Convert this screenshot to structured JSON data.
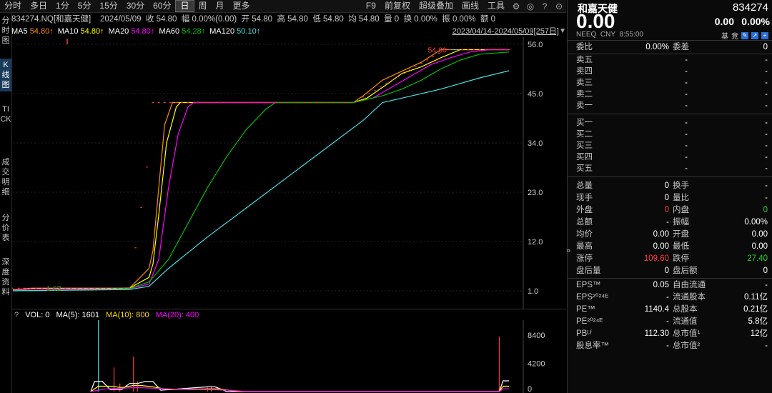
{
  "toolbar": {
    "periods": [
      "分时",
      "多日",
      "1分",
      "5分",
      "15分",
      "30分",
      "60分",
      "日",
      "周",
      "月",
      "更多"
    ],
    "active_period": "日",
    "right_items": [
      "F9",
      "前复权",
      "超级叠加",
      "画线",
      "工具"
    ]
  },
  "left_tabs": [
    "分时图",
    "K线图",
    "TICK",
    "成交明细",
    "分价表",
    "深度资料"
  ],
  "info": {
    "code_name": "834274.NQ[和嘉天健]",
    "date": "2024/05/09",
    "close": "收 54.80",
    "change": "幅 0.00%(0.00)",
    "open": "开 54.80",
    "high": "高 54.80",
    "low": "低 54.80",
    "avg": "均 54.80",
    "volume": "量 0",
    "turnover": "换 0.00%",
    "amplitude": "振 0.00%",
    "amount": "额 0"
  },
  "ma": {
    "items": [
      {
        "name": "MA5",
        "value": "54.80↑",
        "color": "#ffffff",
        "vcolor": "#ff8c00"
      },
      {
        "name": "MA10",
        "value": "54.80↑",
        "color": "#ffffff",
        "vcolor": "#ffff00"
      },
      {
        "name": "MA20",
        "value": "54.80↑",
        "color": "#ffffff",
        "vcolor": "#ff00ff"
      },
      {
        "name": "MA60",
        "value": "54.28↑",
        "color": "#ffffff",
        "vcolor": "#00c000"
      },
      {
        "name": "MA120",
        "value": "50.10↑",
        "color": "#ffffff",
        "vcolor": "#40e0e0"
      }
    ],
    "range": "2023/04/14-2024/05/09[257日]"
  },
  "chart_data": {
    "type": "line",
    "yticks": [
      1.0,
      12.0,
      23.0,
      34.0,
      45.0,
      56.0
    ],
    "ylim": [
      1.0,
      56.0
    ],
    "annotations": [
      {
        "text": "54.80",
        "x": 228,
        "y": 54.8
      },
      {
        "text": "1.62",
        "x": 32,
        "y": 1.62
      }
    ],
    "series": [
      {
        "name": "MA5",
        "color": "#ff8c00",
        "x": [
          0,
          10,
          50,
          60,
          70,
          72,
          75,
          78,
          82,
          84,
          100,
          175,
          180,
          190,
          200,
          210,
          220,
          228,
          240,
          255
        ],
        "y": [
          1.2,
          1.6,
          1.6,
          1.6,
          6,
          10,
          24,
          38,
          43,
          43,
          43,
          43,
          44.5,
          48,
          50,
          52,
          54.8,
          54.8,
          54.8,
          54.8
        ]
      },
      {
        "name": "MA10",
        "color": "#ffff00",
        "x": [
          0,
          10,
          50,
          60,
          70,
          72,
          75,
          79,
          84,
          86,
          100,
          175,
          182,
          192,
          200,
          210,
          220,
          230,
          240,
          255
        ],
        "y": [
          1.2,
          1.5,
          1.5,
          1.6,
          4,
          7,
          18,
          34,
          42,
          43,
          43,
          43,
          44,
          47,
          49.5,
          51,
          53,
          54.8,
          54.8,
          54.8
        ],
        "name_hidden": true
      },
      {
        "name": "MA20",
        "color": "#ff00ff",
        "x": [
          0,
          10,
          50,
          60,
          70,
          75,
          80,
          85,
          90,
          93,
          100,
          175,
          185,
          195,
          205,
          215,
          225,
          235,
          245,
          255
        ],
        "y": [
          1.1,
          1.4,
          1.4,
          1.5,
          2.5,
          8,
          24,
          36,
          42,
          43,
          43,
          43,
          44,
          46.5,
          49,
          51.5,
          53,
          54.3,
          54.8,
          54.8
        ]
      },
      {
        "name": "MA60",
        "color": "#00c000",
        "x": [
          0,
          50,
          60,
          70,
          80,
          90,
          100,
          110,
          120,
          130,
          135,
          175,
          190,
          200,
          210,
          220,
          230,
          240,
          255
        ],
        "y": [
          1.0,
          1.3,
          1.5,
          3,
          8,
          16,
          24,
          31,
          37,
          41.5,
          43,
          43,
          44.5,
          46,
          48,
          50.5,
          52.5,
          53.8,
          54.28
        ]
      },
      {
        "name": "MA120",
        "color": "#40e0e0",
        "x": [
          0,
          60,
          70,
          80,
          100,
          120,
          140,
          160,
          180,
          190,
          200,
          220,
          240,
          255
        ],
        "y": [
          1.0,
          1.3,
          2.0,
          6,
          13,
          19.5,
          26,
          32.5,
          39,
          43,
          44,
          46,
          48.5,
          50.1
        ]
      }
    ],
    "volume": {
      "label": "VOL: 0",
      "ma5": "MA(5): 1601",
      "ma10": "MA(10): 800",
      "ma20": "MA(20): 400",
      "yticks": [
        "8400",
        "4200",
        "0"
      ],
      "ylim": [
        0,
        10000
      ],
      "bars": [
        {
          "x": 44,
          "v": 11000,
          "c": "#40e0e0"
        },
        {
          "x": 52,
          "v": 3600,
          "c": "#ff3b3b"
        },
        {
          "x": 55,
          "v": 1200,
          "c": "#ff3b3b"
        },
        {
          "x": 62,
          "v": 5200,
          "c": "#ff3b3b"
        },
        {
          "x": 64,
          "v": 1500,
          "c": "#ff3b3b"
        },
        {
          "x": 100,
          "v": 600,
          "c": "#ff3b3b"
        },
        {
          "x": 102,
          "v": 800,
          "c": "#ff3b3b"
        },
        {
          "x": 250,
          "v": 8200,
          "c": "#ff3b3b"
        }
      ],
      "ma_lines": [
        {
          "color": "#ffffff",
          "x": [
            40,
            42,
            46,
            50,
            56,
            60,
            64,
            68,
            72,
            76,
            100,
            104,
            110,
            116,
            250,
            252,
            255
          ],
          "y": [
            0,
            1500,
            1500,
            300,
            300,
            1200,
            1200,
            1500,
            1500,
            200,
            700,
            700,
            0,
            0,
            0,
            1600,
            1600
          ]
        },
        {
          "color": "#ffff00",
          "x": [
            40,
            44,
            50,
            56,
            62,
            66,
            72,
            76,
            80,
            100,
            106,
            116,
            250,
            252,
            255
          ],
          "y": [
            0,
            800,
            800,
            600,
            900,
            900,
            700,
            500,
            300,
            400,
            400,
            0,
            0,
            800,
            800
          ]
        },
        {
          "color": "#ff00ff",
          "x": [
            40,
            48,
            56,
            64,
            72,
            80,
            90,
            100,
            112,
            120,
            250,
            252,
            255
          ],
          "y": [
            0,
            400,
            500,
            600,
            500,
            400,
            300,
            300,
            200,
            0,
            0,
            400,
            400
          ]
        }
      ]
    }
  },
  "quote": {
    "name": "和嘉天健",
    "code": "834274",
    "price": "0.00",
    "change": "0.00",
    "pct": "0.00%",
    "market": "NEEQ",
    "currency": "CNY",
    "time": "8:55:00",
    "tag1": "基",
    "tag2": "竞",
    "webi": {
      "label": "委比",
      "value": "0.00%",
      "label2": "委差",
      "value2": "0"
    },
    "sell": [
      {
        "label": "卖五",
        "price": "-",
        "vol": "-"
      },
      {
        "label": "卖四",
        "price": "-",
        "vol": "-"
      },
      {
        "label": "卖三",
        "price": "-",
        "vol": "-"
      },
      {
        "label": "卖二",
        "price": "-",
        "vol": "-"
      },
      {
        "label": "卖一",
        "price": "-",
        "vol": "-"
      }
    ],
    "buy": [
      {
        "label": "买一",
        "price": "-",
        "vol": "-"
      },
      {
        "label": "买二",
        "price": "-",
        "vol": "-"
      },
      {
        "label": "买三",
        "price": "-",
        "vol": "-"
      },
      {
        "label": "买四",
        "price": "-",
        "vol": "-"
      },
      {
        "label": "买五",
        "price": "-",
        "vol": "-"
      }
    ],
    "stats": [
      {
        "l1": "总量",
        "v1": "0",
        "c1": "#ffffff",
        "l2": "换手",
        "v2": "-",
        "c2": "#ffffff"
      },
      {
        "l1": "现手",
        "v1": "0",
        "c1": "#ffffff",
        "l2": "量比",
        "v2": "-",
        "c2": "#ffffff"
      },
      {
        "l1": "外盘",
        "v1": "0",
        "c1": "#ff3b3b",
        "l2": "内盘",
        "v2": "0",
        "c2": "#2cd12c"
      },
      {
        "l1": "总额",
        "v1": "-",
        "c1": "#ffffff",
        "l2": "振幅",
        "v2": "0.00%",
        "c2": "#ffffff"
      },
      {
        "l1": "均价",
        "v1": "0.00",
        "c1": "#ffffff",
        "l2": "开盘",
        "v2": "0.00",
        "c2": "#ffffff"
      },
      {
        "l1": "最高",
        "v1": "0.00",
        "c1": "#ffffff",
        "l2": "最低",
        "v2": "0.00",
        "c2": "#ffffff"
      },
      {
        "l1": "涨停",
        "v1": "109.60",
        "c1": "#ff3b3b",
        "l2": "跌停",
        "v2": "27.40",
        "c2": "#2cd12c"
      },
      {
        "l1": "盘后量",
        "v1": "0",
        "c1": "#ffffff",
        "l2": "盘后额",
        "v2": "0",
        "c2": "#ffffff"
      }
    ],
    "fund": [
      {
        "l1": "EPS™",
        "v1": "0.05",
        "l2": "自由流通",
        "v2": "-"
      },
      {
        "l1": "EPS²⁰²⁴ᴱ",
        "v1": "-",
        "l2": "流通股本",
        "v2": "0.11亿"
      },
      {
        "l1": "PE™",
        "v1": "1140.4",
        "l2": "总股本",
        "v2": "0.21亿"
      },
      {
        "l1": "PE²⁰²⁴ᴱ",
        "v1": "-",
        "l2": "流通值",
        "v2": "5.8亿"
      },
      {
        "l1": "PBᴸᶠ",
        "v1": "112.30",
        "l2": "总市值¹",
        "v2": "12亿"
      },
      {
        "l1": "股息率™",
        "v1": "-",
        "l2": "总市值²",
        "v2": "-"
      }
    ]
  }
}
